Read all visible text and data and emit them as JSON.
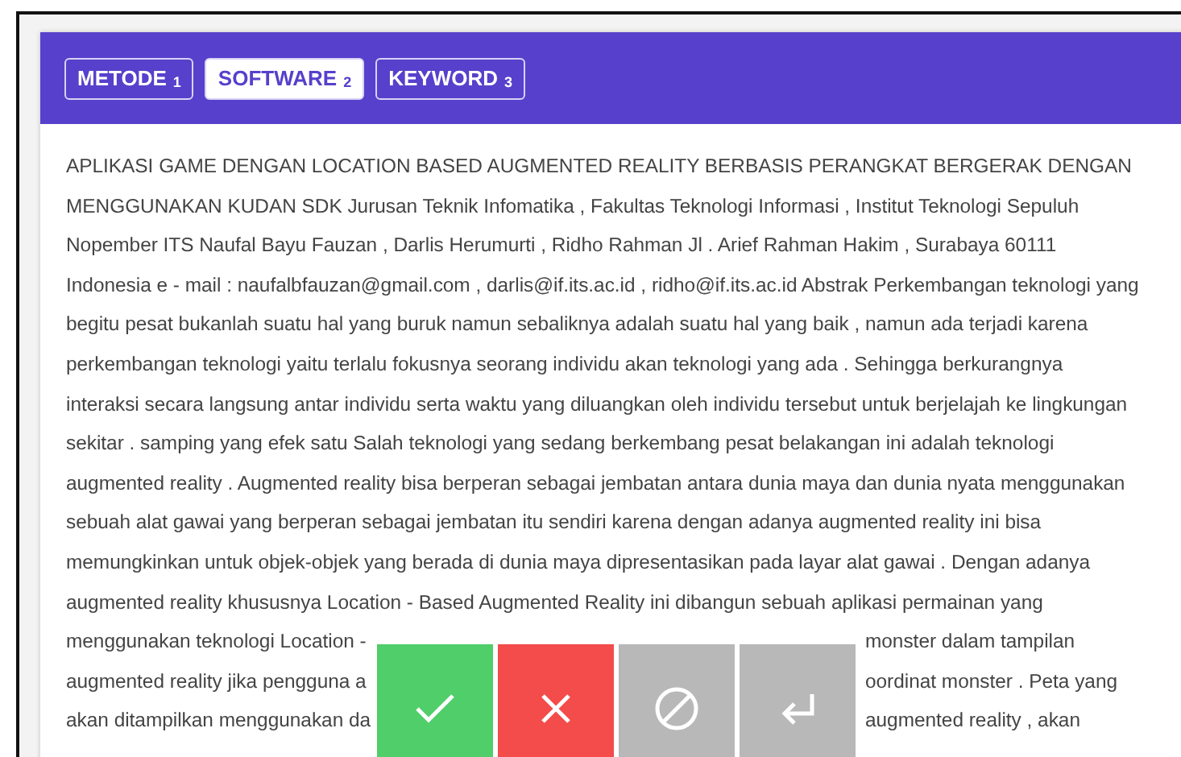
{
  "tabs": [
    {
      "label": "METODE",
      "number": "1",
      "selected": false
    },
    {
      "label": "SOFTWARE",
      "number": "2",
      "selected": true
    },
    {
      "label": "KEYWORD",
      "number": "3",
      "selected": false
    }
  ],
  "lines": [
    {
      "kind": "full",
      "text": "APLIKASI GAME DENGAN LOCATION BASED AUGMENTED REALITY BERBASIS PERANGKAT BERGERAK DENGAN"
    },
    {
      "kind": "full",
      "text": "MENGGUNAKAN KUDAN SDK Jurusan Teknik Infomatika , Fakultas Teknologi Informasi , Institut Teknologi Sepuluh"
    },
    {
      "kind": "full",
      "text": "Nopember ITS Naufal Bayu Fauzan , Darlis Herumurti , Ridho Rahman Jl . Arief Rahman Hakim , Surabaya 60111"
    },
    {
      "kind": "full",
      "text": "Indonesia e - mail : naufalbfauzan@gmail.com , darlis@if.its.ac.id , ridho@if.its.ac.id Abstrak Perkembangan teknologi yang"
    },
    {
      "kind": "full",
      "text": "begitu pesat bukanlah suatu hal yang buruk namun sebaliknya adalah suatu hal yang baik , namun ada terjadi karena"
    },
    {
      "kind": "full",
      "text": "perkembangan teknologi yaitu terlalu fokusnya seorang individu akan teknologi yang ada . Sehingga berkurangnya"
    },
    {
      "kind": "full",
      "text": "interaksi secara langsung antar individu serta waktu yang diluangkan oleh individu tersebut untuk berjelajah ke lingkungan"
    },
    {
      "kind": "full",
      "text": "sekitar . samping yang efek satu Salah teknologi yang sedang berkembang pesat belakangan ini adalah teknologi"
    },
    {
      "kind": "full",
      "text": "augmented reality . Augmented reality bisa berperan sebagai jembatan antara dunia maya dan dunia nyata menggunakan"
    },
    {
      "kind": "full",
      "text": "sebuah alat gawai yang berperan sebagai jembatan itu sendiri karena dengan adanya augmented reality ini bisa"
    },
    {
      "kind": "full",
      "text": "memungkinkan untuk objek-objek yang berada di dunia maya dipresentasikan pada layar alat gawai . Dengan adanya"
    },
    {
      "kind": "full",
      "text": "augmented reality khususnya Location - Based Augmented Reality ini dibangun sebuah aplikasi permainan yang"
    },
    {
      "kind": "split",
      "left": "menggunakan teknologi Location -",
      "right": "monster dalam tampilan"
    },
    {
      "kind": "split",
      "left": "augmented reality jika pengguna a",
      "right": "oordinat monster . Peta yang"
    },
    {
      "kind": "split",
      "left": "akan ditampilkan menggunakan da",
      "right": "augmented reality , akan"
    }
  ],
  "actions": [
    {
      "kind": "accept"
    },
    {
      "kind": "reject"
    },
    {
      "kind": "skip"
    },
    {
      "kind": "return"
    }
  ]
}
